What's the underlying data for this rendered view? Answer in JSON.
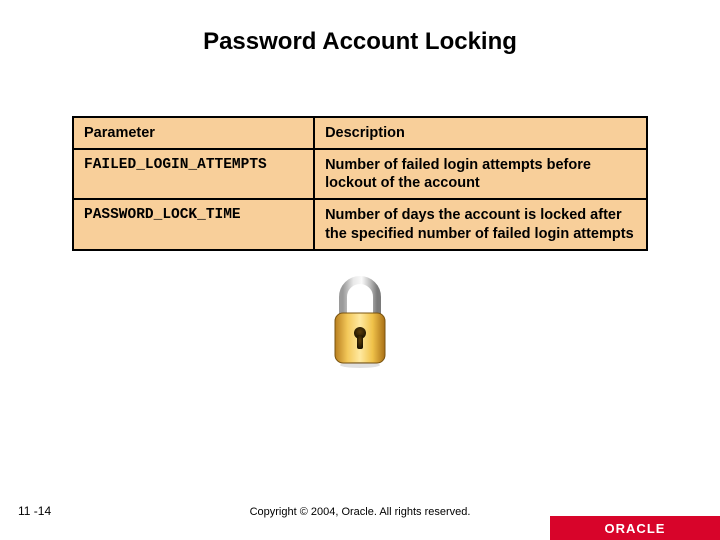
{
  "title": "Password Account Locking",
  "table": {
    "headers": {
      "param": "Parameter",
      "desc": "Description"
    },
    "rows": [
      {
        "param": "FAILED_LOGIN_ATTEMPTS",
        "desc": "Number of failed login attempts before lockout of the account"
      },
      {
        "param": "PASSWORD_LOCK_TIME",
        "desc": "Number of days the account is locked after the specified number of failed login attempts"
      }
    ]
  },
  "footer": {
    "page": "11 -14",
    "copyright": "Copyright © 2004, Oracle. All rights reserved.",
    "logo": "ORACLE"
  }
}
